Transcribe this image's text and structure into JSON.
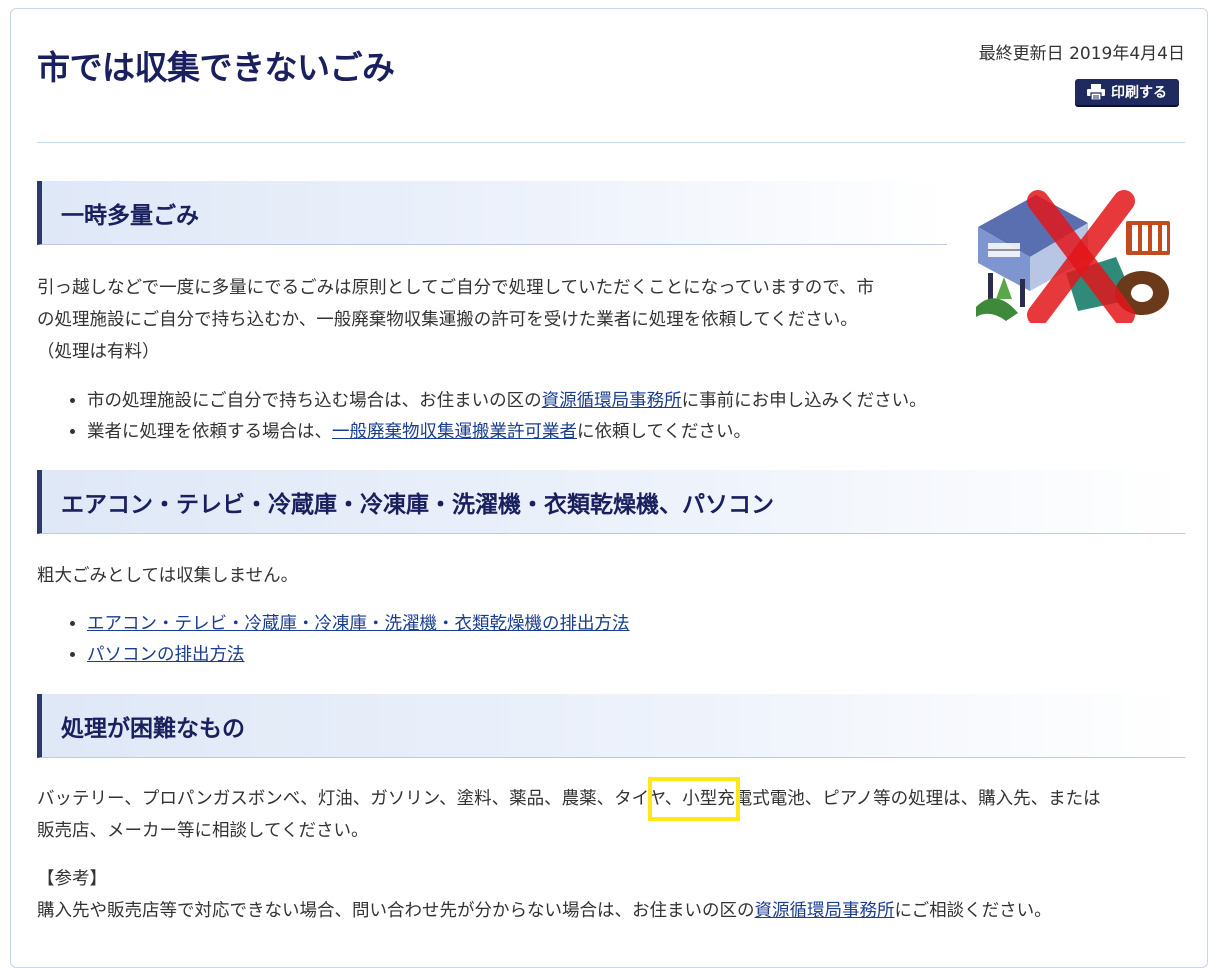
{
  "page": {
    "title": "市では収集できないごみ",
    "updated": "最終更新日 2019年4月4日",
    "print_label": "印刷する"
  },
  "section1": {
    "heading": "一時多量ごみ",
    "para_line1": "引っ越しなどで一度に多量にでるごみは原則としてご自分で処理していただくことになっていますので、市",
    "para_line2": "の処理施設にご自分で持ち込むか、一般廃棄物収集運搬の許可を受けた業者に処理を依頼してください。",
    "para_line3": "（処理は有料）",
    "bullets": [
      {
        "pre": "市の処理施設にご自分で持ち込む場合は、お住まいの区の",
        "link": "資源循環局事務所",
        "post": "に事前にお申し込みください。"
      },
      {
        "pre": "業者に処理を依頼する場合は、",
        "link": "一般廃棄物収集運搬業許可業者",
        "post": "に依頼してください。"
      }
    ],
    "illustration_icon": "no-bulky-items-icon"
  },
  "section2": {
    "heading": "エアコン・テレビ・冷蔵庫・冷凍庫・洗濯機・衣類乾燥機、パソコン",
    "para": "粗大ごみとしては収集しません。",
    "links": [
      "エアコン・テレビ・冷蔵庫・冷凍庫・洗濯機・衣類乾燥機の排出方法",
      "パソコンの排出方法"
    ]
  },
  "section3": {
    "heading": "処理が困難なもの",
    "para_part1": "バッテリー、プロパンガスボンベ、灯油、ガソリン、塗料、薬品、農薬、",
    "para_highlight": "タイヤ、",
    "para_part2": "小型充電式電池、ピアノ等の処理は、購入先、または",
    "para_line2": "販売店、メーカー等に相談してください。",
    "ref_label": "【参考】",
    "ref_pre": "購入先や販売店等で対応できない場合、問い合わせ先が分からない場合は、お住まいの区の",
    "ref_link": "資源循環局事務所",
    "ref_post": "にご相談ください。"
  },
  "colors": {
    "heading_text": "#1a1f5e",
    "link": "#1a3d8f",
    "highlight": "#ffe819"
  }
}
